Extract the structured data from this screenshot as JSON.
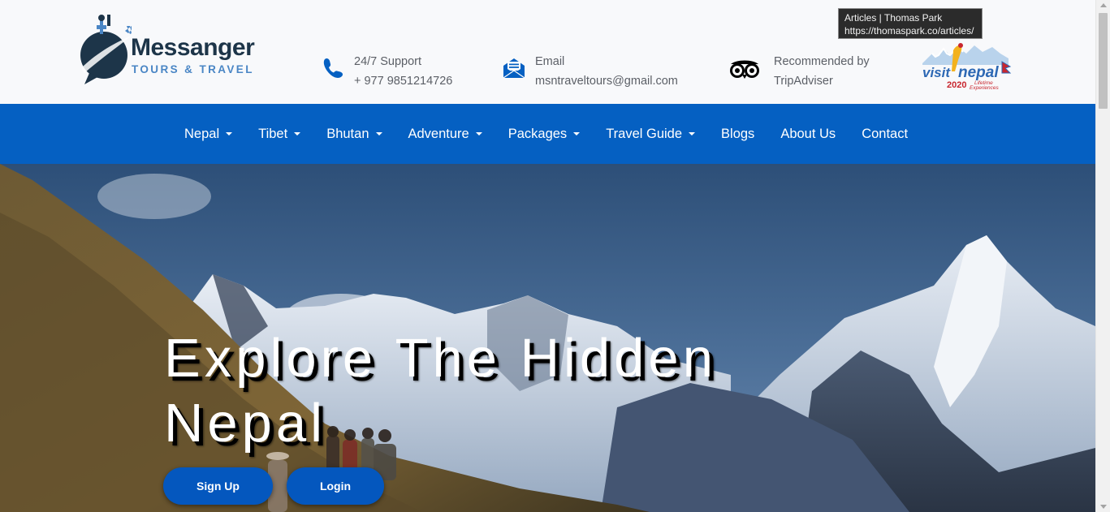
{
  "brand": {
    "name": "Messanger",
    "tagline": "TOURS & TRAVEL"
  },
  "header": {
    "support": {
      "label": "24/7 Support",
      "value": "+ 977 9851214726",
      "icon": "phone-icon"
    },
    "email": {
      "label": "Email",
      "value": "msntraveltours@gmail.com",
      "icon": "envelope-icon"
    },
    "tripadvisor": {
      "label": "Recommended by",
      "value": "TripAdviser",
      "icon": "tripadvisor-owl-icon"
    },
    "badge": {
      "icon": "visit-nepal-2020-logo"
    }
  },
  "tooltip": {
    "title": "Articles | Thomas Park",
    "url": "https://thomaspark.co/articles/"
  },
  "nav": {
    "items": [
      {
        "label": "Nepal",
        "dropdown": true
      },
      {
        "label": "Tibet",
        "dropdown": true
      },
      {
        "label": "Bhutan",
        "dropdown": true
      },
      {
        "label": "Adventure",
        "dropdown": true
      },
      {
        "label": "Packages",
        "dropdown": true
      },
      {
        "label": "Travel Guide",
        "dropdown": true
      },
      {
        "label": "Blogs",
        "dropdown": false
      },
      {
        "label": "About Us",
        "dropdown": false
      },
      {
        "label": "Contact",
        "dropdown": false
      }
    ]
  },
  "hero": {
    "title": "Explore The Hidden Nepal",
    "buttons": {
      "signup": "Sign Up",
      "login": "Login"
    }
  },
  "colors": {
    "nav_background": "#0560c2",
    "button_background": "#0457be",
    "brand_dark": "#1d3549",
    "brand_light": "#4a86c5",
    "header_background": "#f8f9fb"
  }
}
